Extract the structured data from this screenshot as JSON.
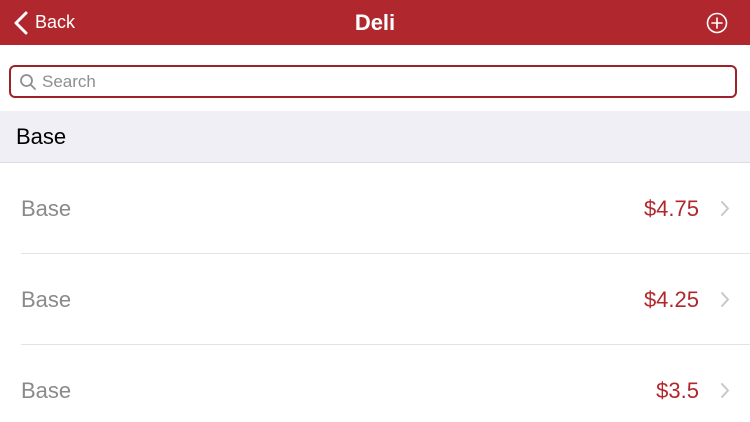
{
  "navbar": {
    "back_label": "Back",
    "title": "Deli",
    "add_icon": "plus-circle-icon",
    "back_icon": "chevron-left-icon"
  },
  "search": {
    "placeholder": "Search",
    "value": "",
    "icon": "search-icon"
  },
  "section": {
    "title": "Base"
  },
  "items": [
    {
      "name": "Base",
      "price": "$4.75"
    },
    {
      "name": "Base",
      "price": "$4.25"
    },
    {
      "name": "Base",
      "price": "$3.5"
    }
  ],
  "colors": {
    "brand": "#b0282d",
    "price": "#b0282d",
    "item_text": "#8a8a8a",
    "section_bg": "#f0eff5"
  }
}
